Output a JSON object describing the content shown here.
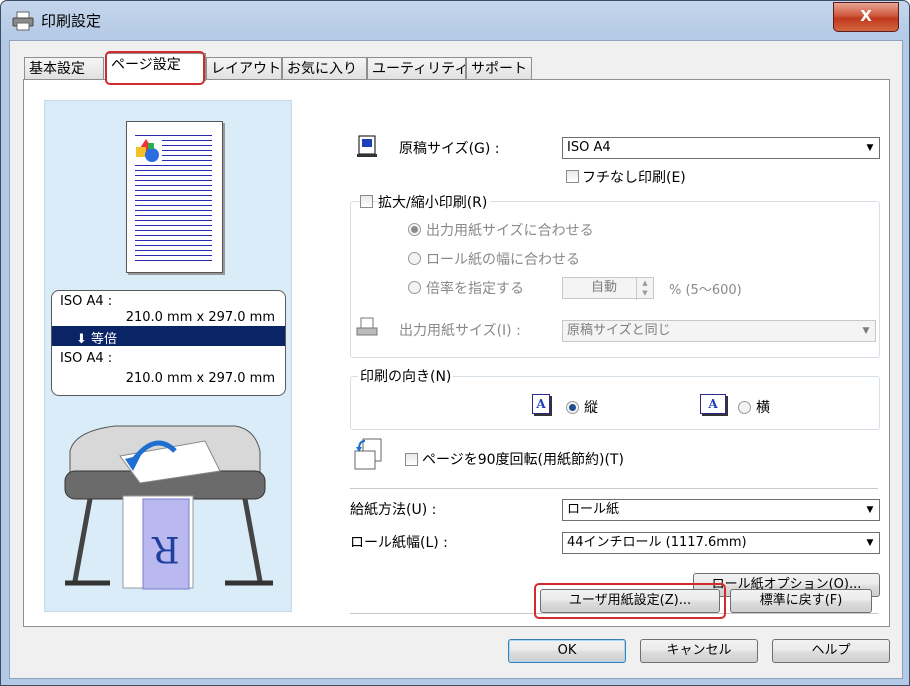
{
  "window": {
    "title": "印刷設定",
    "close_label": "X"
  },
  "tabs": [
    {
      "label": "基本設定"
    },
    {
      "label": "ページ設定"
    },
    {
      "label": "レイアウト"
    },
    {
      "label": "お気に入り"
    },
    {
      "label": "ユーティリティ"
    },
    {
      "label": "サポート"
    }
  ],
  "active_tab": "ページ設定",
  "preview": {
    "source_size": "ISO A4 :",
    "source_dims": "210.0 mm x 297.0 mm",
    "scale_label": "⬇  等倍",
    "output_size": "ISO A4 :",
    "output_dims": "210.0 mm x 297.0 mm",
    "sheet_letter": "R"
  },
  "page_size": {
    "label": "原稿サイズ(G) :",
    "value": "ISO A4",
    "borderless_label": "フチなし印刷(E)",
    "borderless_checked": false
  },
  "scaling": {
    "checkbox_label": "拡大/縮小印刷(R)",
    "checked": false,
    "options": [
      {
        "label": "出力用紙サイズに合わせる",
        "selected": true
      },
      {
        "label": "ロール紙の幅に合わせる",
        "selected": false
      },
      {
        "label": "倍率を指定する",
        "selected": false
      }
    ],
    "scale_value": "自動",
    "scale_range": "% (5～600)",
    "output_size_label": "出力用紙サイズ(I) :",
    "output_size_value": "原稿サイズと同じ"
  },
  "orientation": {
    "label": "印刷の向き(N)",
    "portrait_label": "縦",
    "landscape_label": "横",
    "selected": "縦",
    "icon_letter": "A"
  },
  "rotate": {
    "label": "ページを90度回転(用紙節約)(T)",
    "checked": false
  },
  "paper_source": {
    "label": "給紙方法(U) :",
    "value": "ロール紙"
  },
  "roll_width": {
    "label": "ロール紙幅(L) :",
    "value": "44インチロール (1117.6mm)"
  },
  "buttons": {
    "roll_options": "ロール紙オプション(O)...",
    "custom_size": "ユーザ用紙設定(Z)...",
    "defaults": "標準に戻す(F)",
    "ok": "OK",
    "cancel": "キャンセル",
    "help": "ヘルプ"
  },
  "colors": {
    "highlight": "#d32b2b",
    "band": "#0a2466",
    "preview_bg": "#d9ecf7"
  }
}
